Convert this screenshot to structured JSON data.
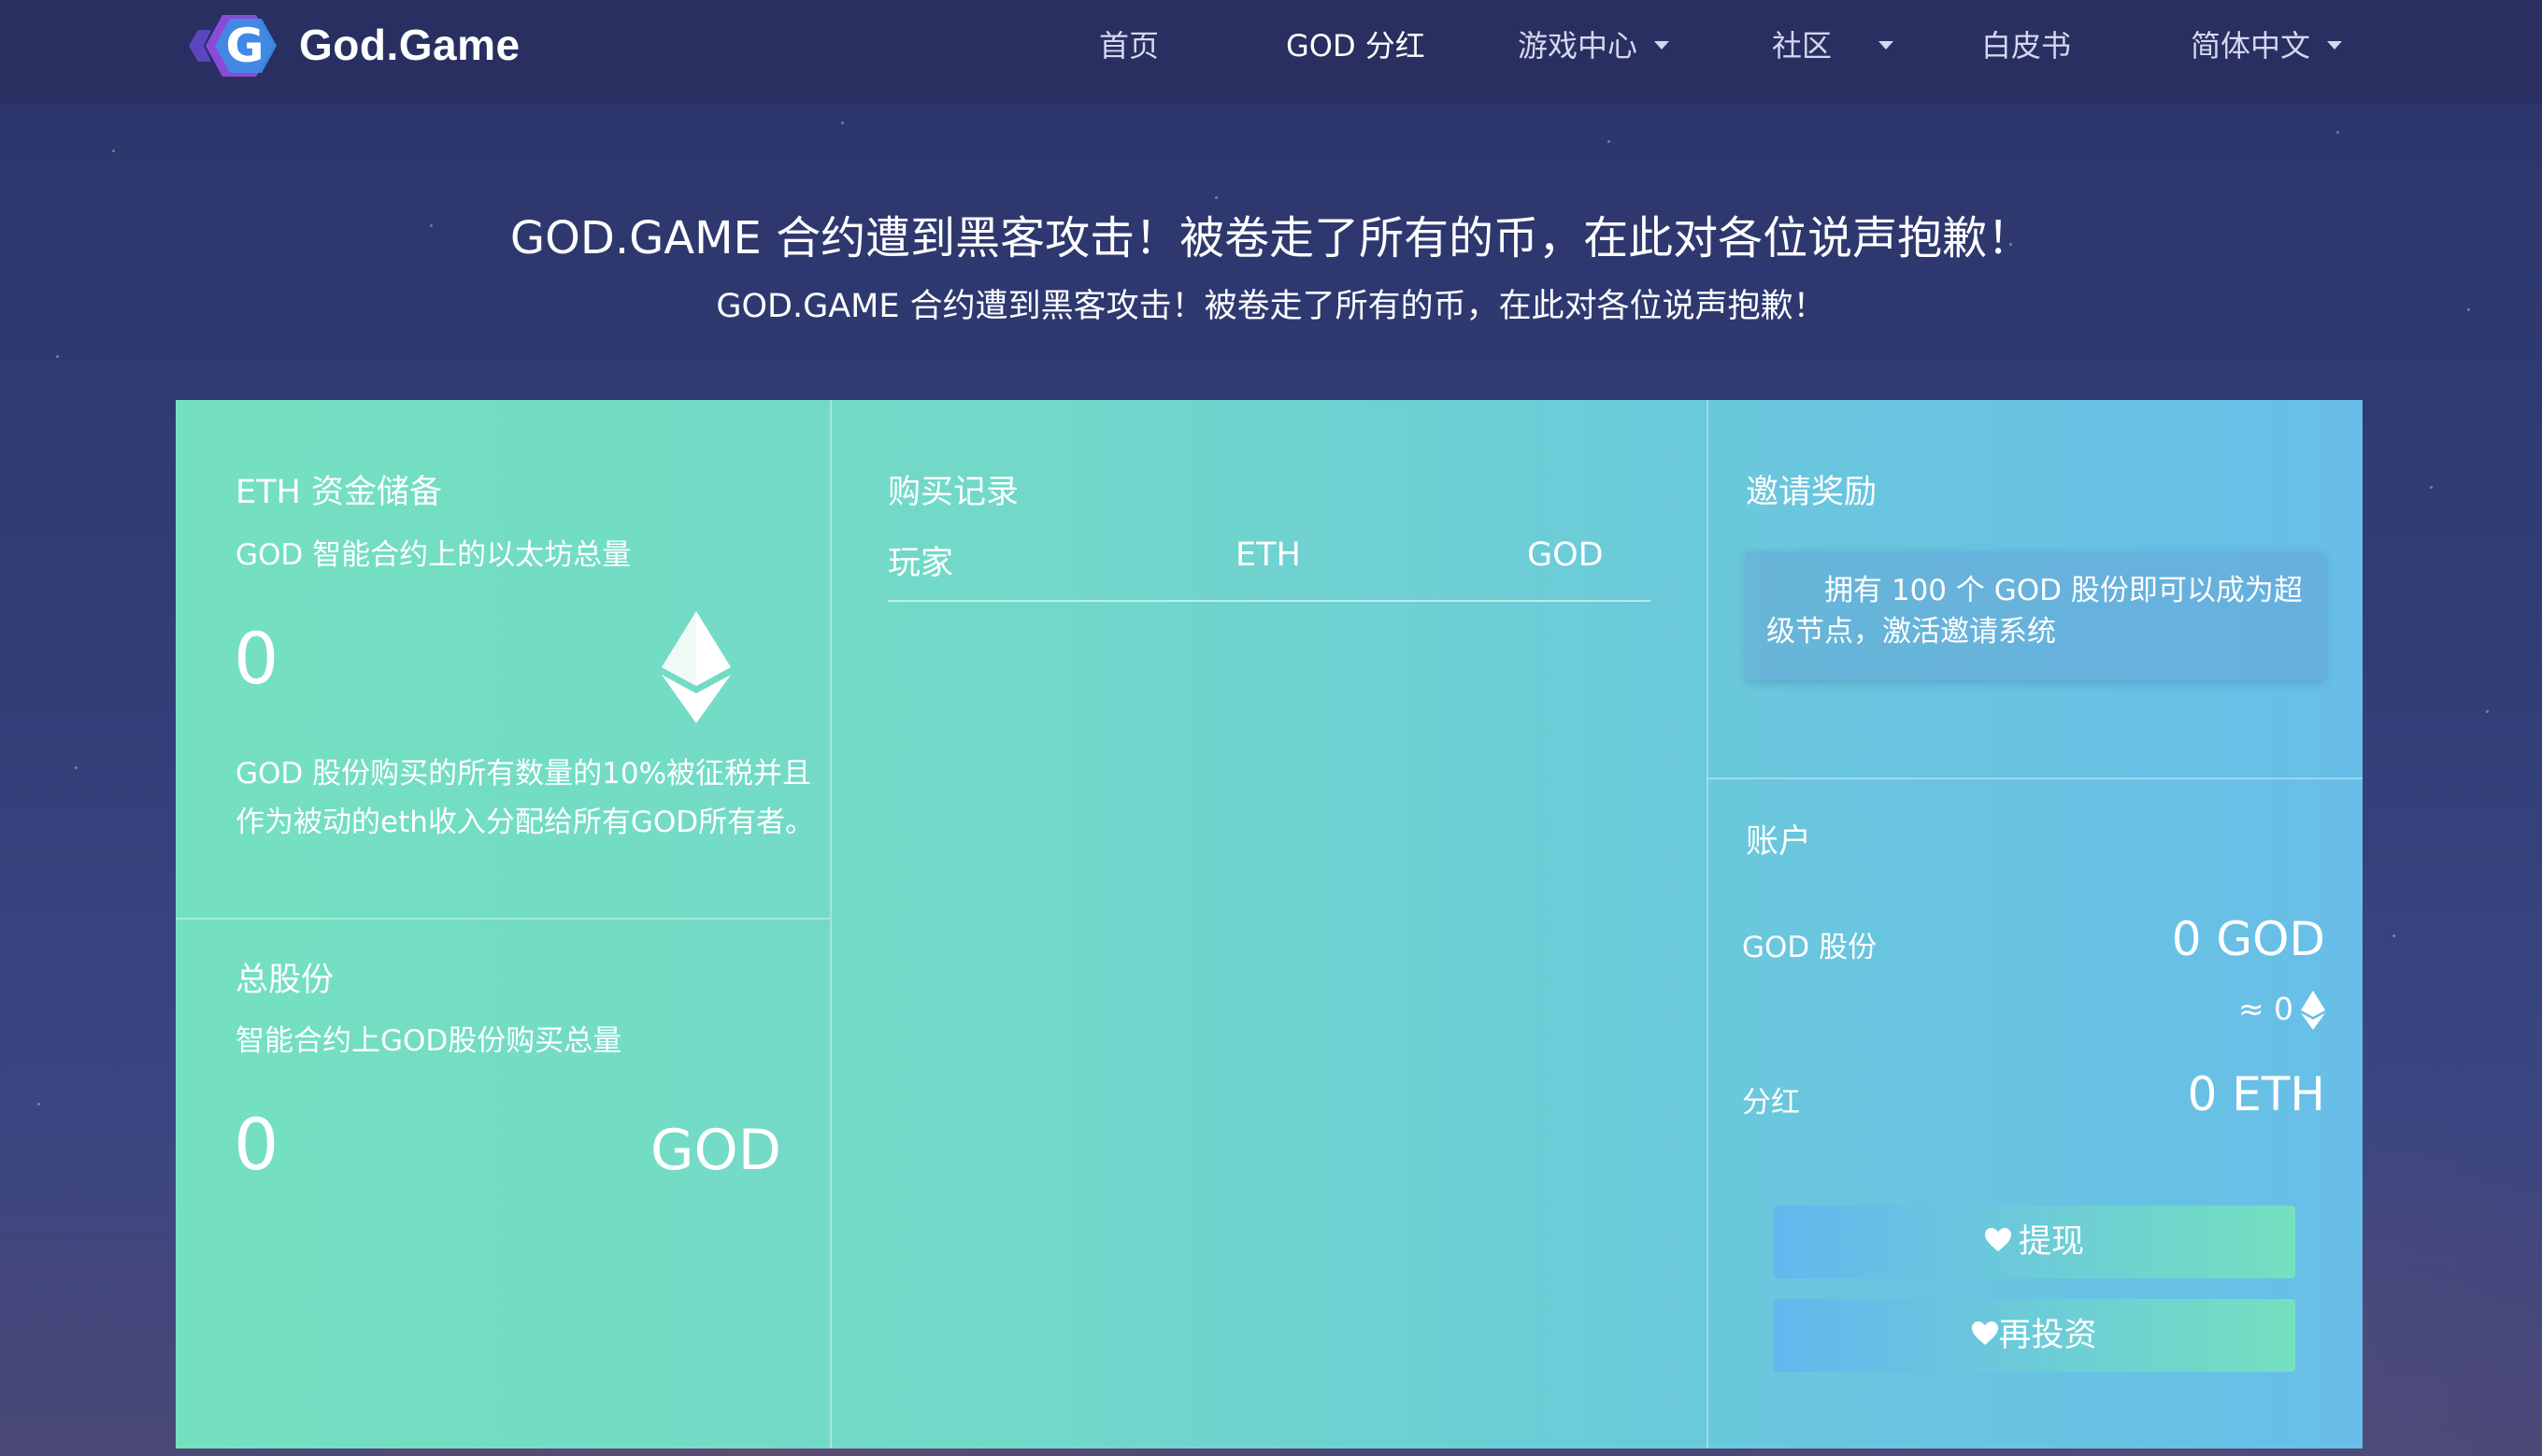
{
  "header": {
    "brand": "God.Game",
    "nav": {
      "home": "首页",
      "dividend": "GOD 分红",
      "game_center": "游戏中心",
      "community": "社区",
      "whitepaper": "白皮书",
      "language": "简体中文"
    }
  },
  "announcement": {
    "title": "GOD.GAME 合约遭到黑客攻击！被卷走了所有的币，在此对各位说声抱歉！",
    "subtitle": "GOD.GAME 合约遭到黑客攻击！被卷走了所有的币，在此对各位说声抱歉！"
  },
  "eth_reserve": {
    "title": "ETH 资金储备",
    "subtitle": "GOD 智能合约上的以太坊总量",
    "value": "0",
    "description": "GOD 股份购买的所有数量的10%被征税并且作为被动的eth收入分配给所有GOD所有者。"
  },
  "total_shares": {
    "title": "总股份",
    "subtitle": "智能合约上GOD股份购买总量",
    "value": "0",
    "unit": "GOD"
  },
  "purchase_records": {
    "title": "购买记录",
    "columns": [
      "玩家",
      "ETH",
      "GOD"
    ]
  },
  "invite": {
    "title": "邀请奖励",
    "message": "拥有 100 个 GOD 股份即可以成为超级节点，激活邀请系统"
  },
  "account": {
    "title": "账户",
    "shares_label": "GOD 股份",
    "shares_value": "0 GOD",
    "approx_eth": "≈ 0",
    "dividend_label": "分红",
    "dividend_value": "0 ETH",
    "withdraw_label": "提现",
    "reinvest_label": "再投资"
  },
  "colors": {
    "panel_start": "#74e0c0",
    "panel_end": "#68bee8",
    "background": "#313c76",
    "logo_hex_blue": "#3b8fe6",
    "logo_hex_purple": "#8a4bd8"
  }
}
